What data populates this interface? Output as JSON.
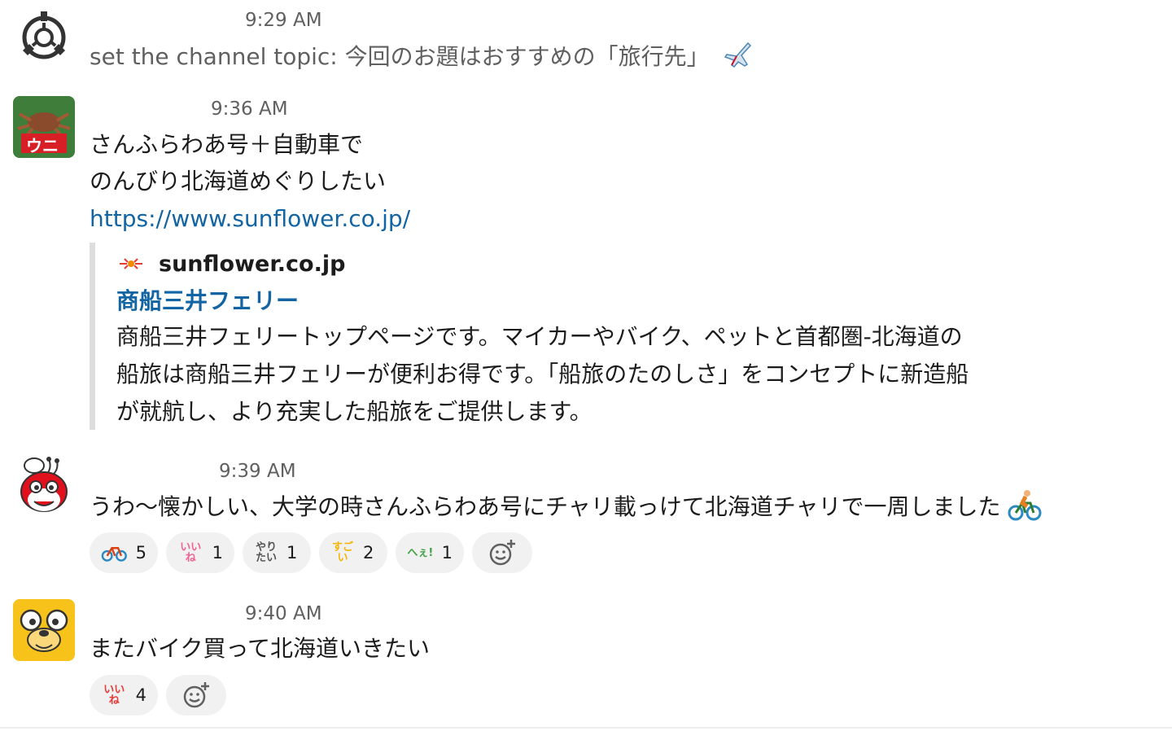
{
  "messages": [
    {
      "time": "9:29 AM",
      "text": "set the channel topic: 今回のお題はおすすめの「旅行先」",
      "text_emoji_icon": "airplane-icon"
    },
    {
      "time": "9:36 AM",
      "line1": "さんふらわあ号＋自動車で",
      "line2": "のんびり北海道めぐりしたい",
      "link": "https://www.sunflower.co.jp/",
      "avatar_text": "ウニ",
      "unfurl": {
        "site": "sunflower.co.jp",
        "title": "商船三井フェリー",
        "desc1": "商船三井フェリートップページです。マイカーやバイク、ペットと首都圏-北海道の",
        "desc2": "船旅は商船三井フェリーが便利お得です。「船旅のたのしさ」をコンセプトに新造船",
        "desc3": "が就航し、より充実した船旅をご提供します。"
      }
    },
    {
      "time": "9:39 AM",
      "text": "うわ～懐かしい、大学の時さんふらわあ号にチャリ載っけて北海道チャリで一周しました",
      "text_emoji_icon": "person-biking-icon",
      "reactions": [
        {
          "icon": "bicycle-icon",
          "count": "5"
        },
        {
          "icon": "iine-text-icon",
          "label": "いいね",
          "count": "1"
        },
        {
          "icon": "yaritai-text-icon",
          "label": "やりたい",
          "count": "1"
        },
        {
          "icon": "sugoi-text-icon",
          "label": "すごい",
          "count": "2"
        },
        {
          "icon": "hee-text-icon",
          "label": "へぇ!",
          "count": "1"
        }
      ]
    },
    {
      "time": "9:40 AM",
      "text": "またバイク買って北海道いきたい",
      "reactions": [
        {
          "icon": "iine-text-icon",
          "label": "いいね",
          "count": "4"
        }
      ]
    }
  ],
  "colors": {
    "link": "#1264a3",
    "timestamp": "#616061",
    "reaction_bg": "#f1f1f1",
    "unfurl_bar": "#dddddd",
    "jake_yellow": "#f7c21a",
    "jollibee_red": "#e0101c"
  }
}
